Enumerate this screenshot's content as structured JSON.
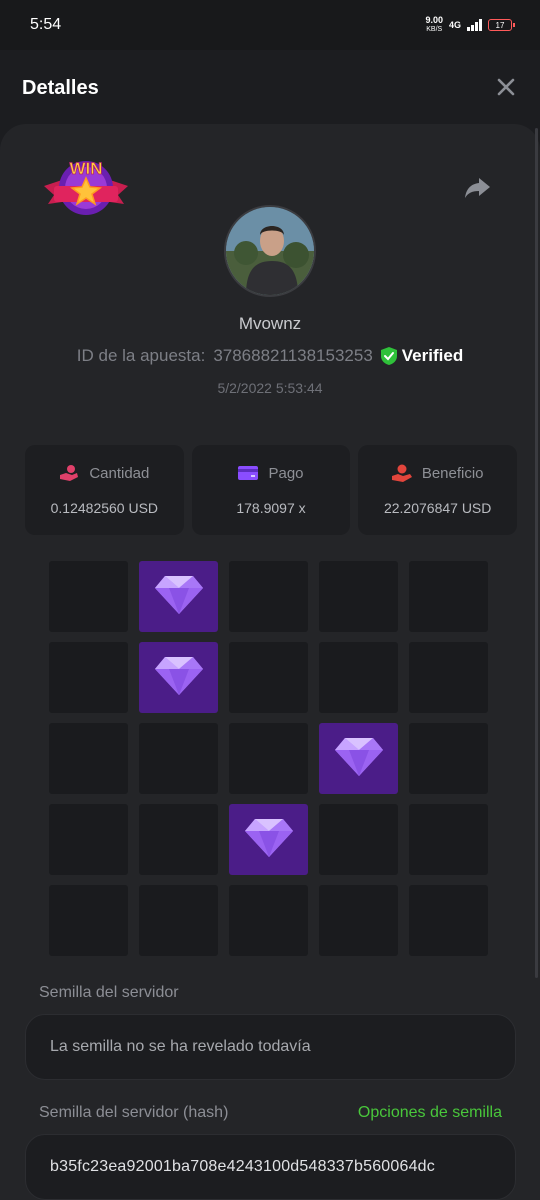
{
  "status_bar": {
    "time": "5:54",
    "net_speed": "9.00",
    "net_unit": "KB/S",
    "network": "4G",
    "battery": "17"
  },
  "header": {
    "title": "Detalles",
    "close_icon": "close-icon"
  },
  "bet": {
    "badge_text": "WIN",
    "username": "Mvownz",
    "id_label": "ID de la apuesta:",
    "id_value": "37868821138153253",
    "verified_label": "Verified",
    "date": "5/2/2022 5:53:44"
  },
  "stats": [
    {
      "label": "Cantidad",
      "value": "0.12482560 USD",
      "icon": "coins-hand-icon"
    },
    {
      "label": "Pago",
      "value": "178.9097 x",
      "icon": "card-icon"
    },
    {
      "label": "Beneficio",
      "value": "22.2076847 USD",
      "icon": "profit-hand-icon"
    }
  ],
  "board": {
    "rows": 5,
    "cols": 5,
    "gems": [
      [
        0,
        1
      ],
      [
        1,
        1
      ],
      [
        2,
        3
      ],
      [
        3,
        2
      ]
    ]
  },
  "server_seed": {
    "label": "Semilla del servidor",
    "value": "La semilla no se ha revelado todavía"
  },
  "server_seed_hash": {
    "label": "Semilla del servidor (hash)",
    "options_link": "Opciones de semilla",
    "value": "b35fc23ea92001ba708e4243100d548337b560064dc"
  },
  "colors": {
    "accent_green": "#49c73b",
    "gem_tile": "#4b1d88",
    "stat_icon_pink": "#e0406a",
    "stat_icon_purple": "#8a4dff",
    "stat_icon_red": "#e2453c"
  }
}
